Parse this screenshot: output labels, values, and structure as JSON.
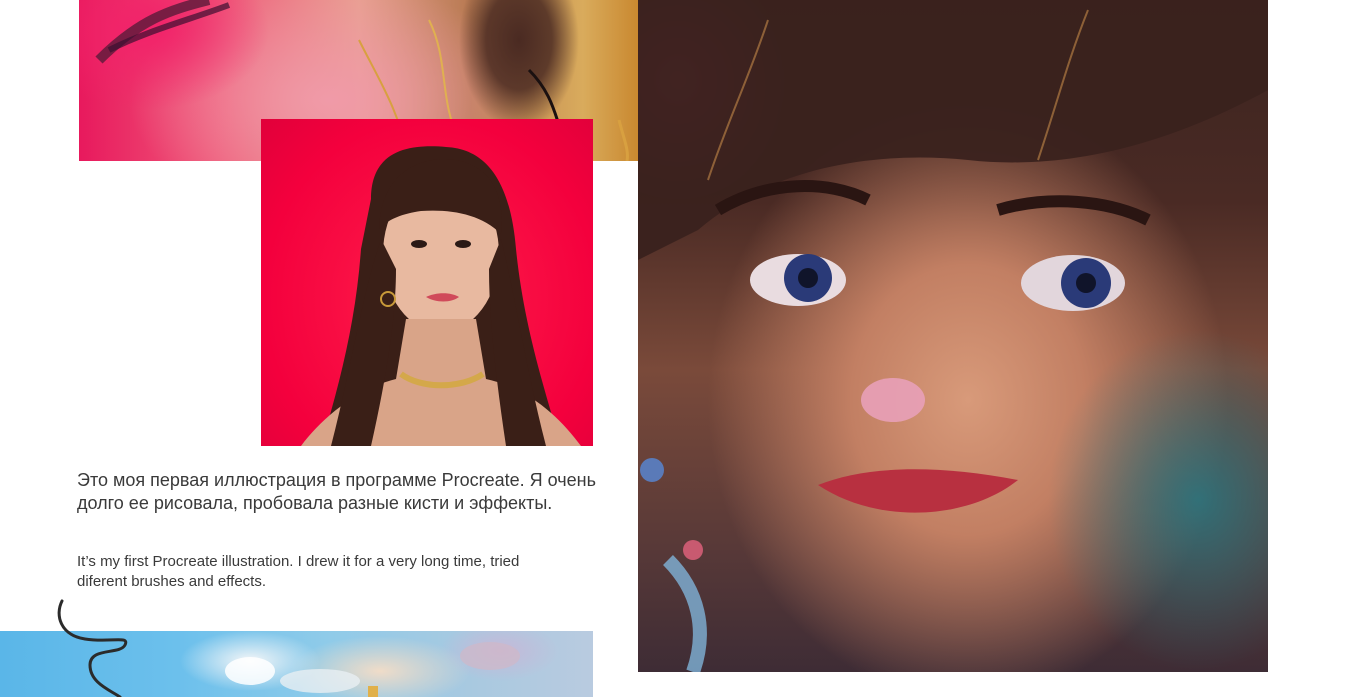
{
  "gallery": {
    "images": [
      {
        "name": "top-painting"
      },
      {
        "name": "reference-photo"
      },
      {
        "name": "portrait-painting"
      },
      {
        "name": "sky-painting"
      }
    ]
  },
  "description": {
    "ru": "Это моя первая иллюстрация в программе Procreate. Я очень долго ее рисовала, пробовала разные кисти и эффекты.",
    "en": "It’s my first Procreate illustration. I drew it for a very long time, tried diferent brushes and effects."
  },
  "colors": {
    "text": "#3a3a3a",
    "background": "#ffffff",
    "photo_background": "#f4003d",
    "accent_pink": "#e8195d"
  }
}
